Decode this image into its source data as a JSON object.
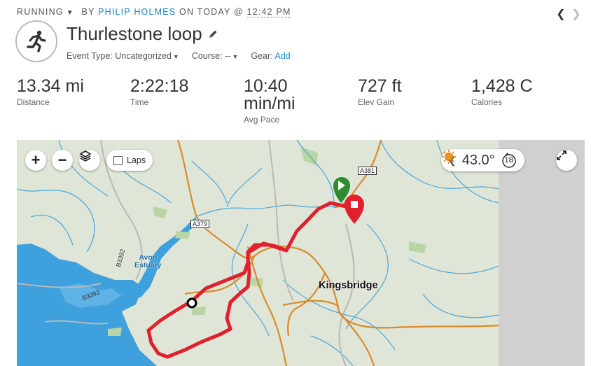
{
  "header": {
    "activity_type": "RUNNING",
    "by_label": "BY",
    "author": "PHILIP HOLMES",
    "on_label": "ON TODAY @",
    "time": "12:42 PM"
  },
  "activity": {
    "title": "Thurlestone loop",
    "event_type_label": "Event Type:",
    "event_type_value": "Uncategorized",
    "course_label": "Course:",
    "course_value": "--",
    "gear_label": "Gear:",
    "gear_add": "Add"
  },
  "stats": [
    {
      "value": "13.34 mi",
      "label": "Distance"
    },
    {
      "value": "2:22:18",
      "label": "Time"
    },
    {
      "value": "10:40 min/mi",
      "value_line1": "10:40",
      "value_line2": "min/mi",
      "label": "Avg Pace"
    },
    {
      "value": "727 ft",
      "label": "Elev Gain"
    },
    {
      "value": "1,428 C",
      "label": "Calories"
    }
  ],
  "map": {
    "controls": {
      "zoom_in": "+",
      "zoom_out": "−",
      "laps_label": "Laps"
    },
    "weather": {
      "temperature": "43.0°",
      "wind_speed": "18",
      "icon": "sun-icon"
    },
    "places": {
      "town": "Kingsbridge",
      "estuary_line1": "Avon",
      "estuary_line2": "Estuary"
    },
    "roads": {
      "a381": "A381",
      "a379": "A379",
      "b3392_north": "B3392",
      "b3392_south": "B3392"
    },
    "colors": {
      "route": "#e0202c",
      "water": "#3ea0dc",
      "land": "#dfe6d7",
      "start": "#2e8b2e",
      "end": "#e0202c"
    }
  }
}
